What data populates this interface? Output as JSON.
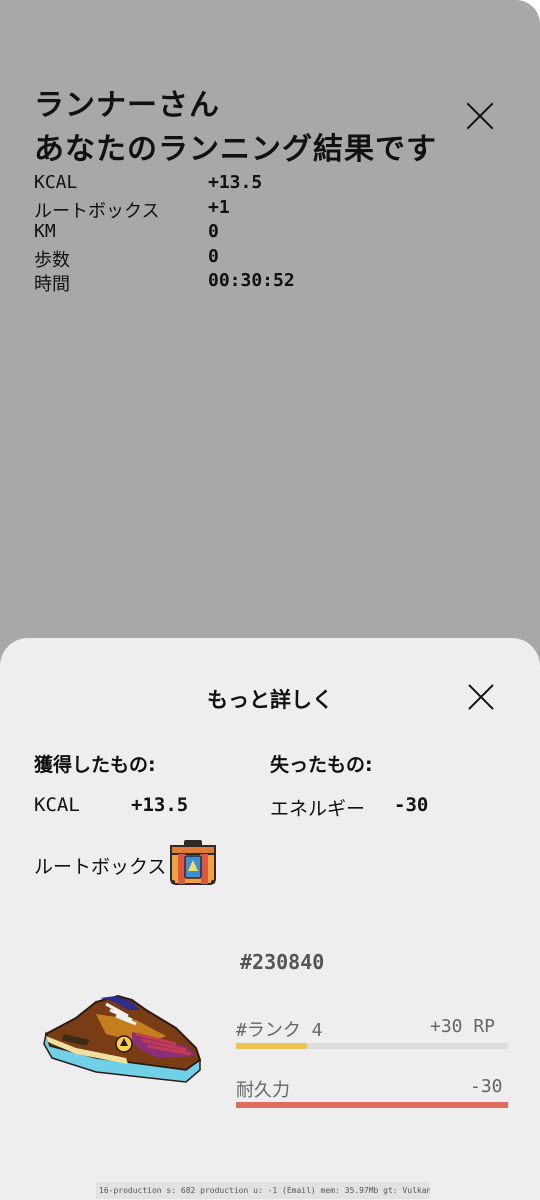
{
  "summary": {
    "greeting_line1": "ランナーさん",
    "greeting_line2": "あなたのランニング結果です",
    "close_icon": "close-icon",
    "stats": [
      {
        "label": "KCAL",
        "value": "+13.5"
      },
      {
        "label": "ルートボックス",
        "value": "+1"
      },
      {
        "label": "KM",
        "value": "0"
      },
      {
        "label": "歩数",
        "value": "0"
      },
      {
        "label": "時間",
        "value": "00:30:52"
      }
    ]
  },
  "details": {
    "title": "もっと詳しく",
    "close_icon": "close-icon",
    "gained_heading": "獲得したもの:",
    "lost_heading": "失ったもの:",
    "gained_kcal_label": "KCAL",
    "gained_kcal_value": "+13.5",
    "lost_energy_label": "エネルギー",
    "lost_energy_value": "-30",
    "lootbox_label": "ルートボックス",
    "lootbox_icon": "lootbox-icon"
  },
  "sneaker": {
    "id": "#230840",
    "rank_label": "#ランク 4",
    "rank_points": "+30 RP",
    "rank_progress": 0.26,
    "durability_label": "耐久力",
    "durability_change": "-30",
    "durability_level": 1.0,
    "colors": {
      "rank_bar": "#f1c04e",
      "durability_bar": "#df6b5a"
    }
  },
  "debug": {
    "text": "16-production s: 682 production u: -1 (Email) mem: 35.97Mb gt: Vulkan"
  }
}
